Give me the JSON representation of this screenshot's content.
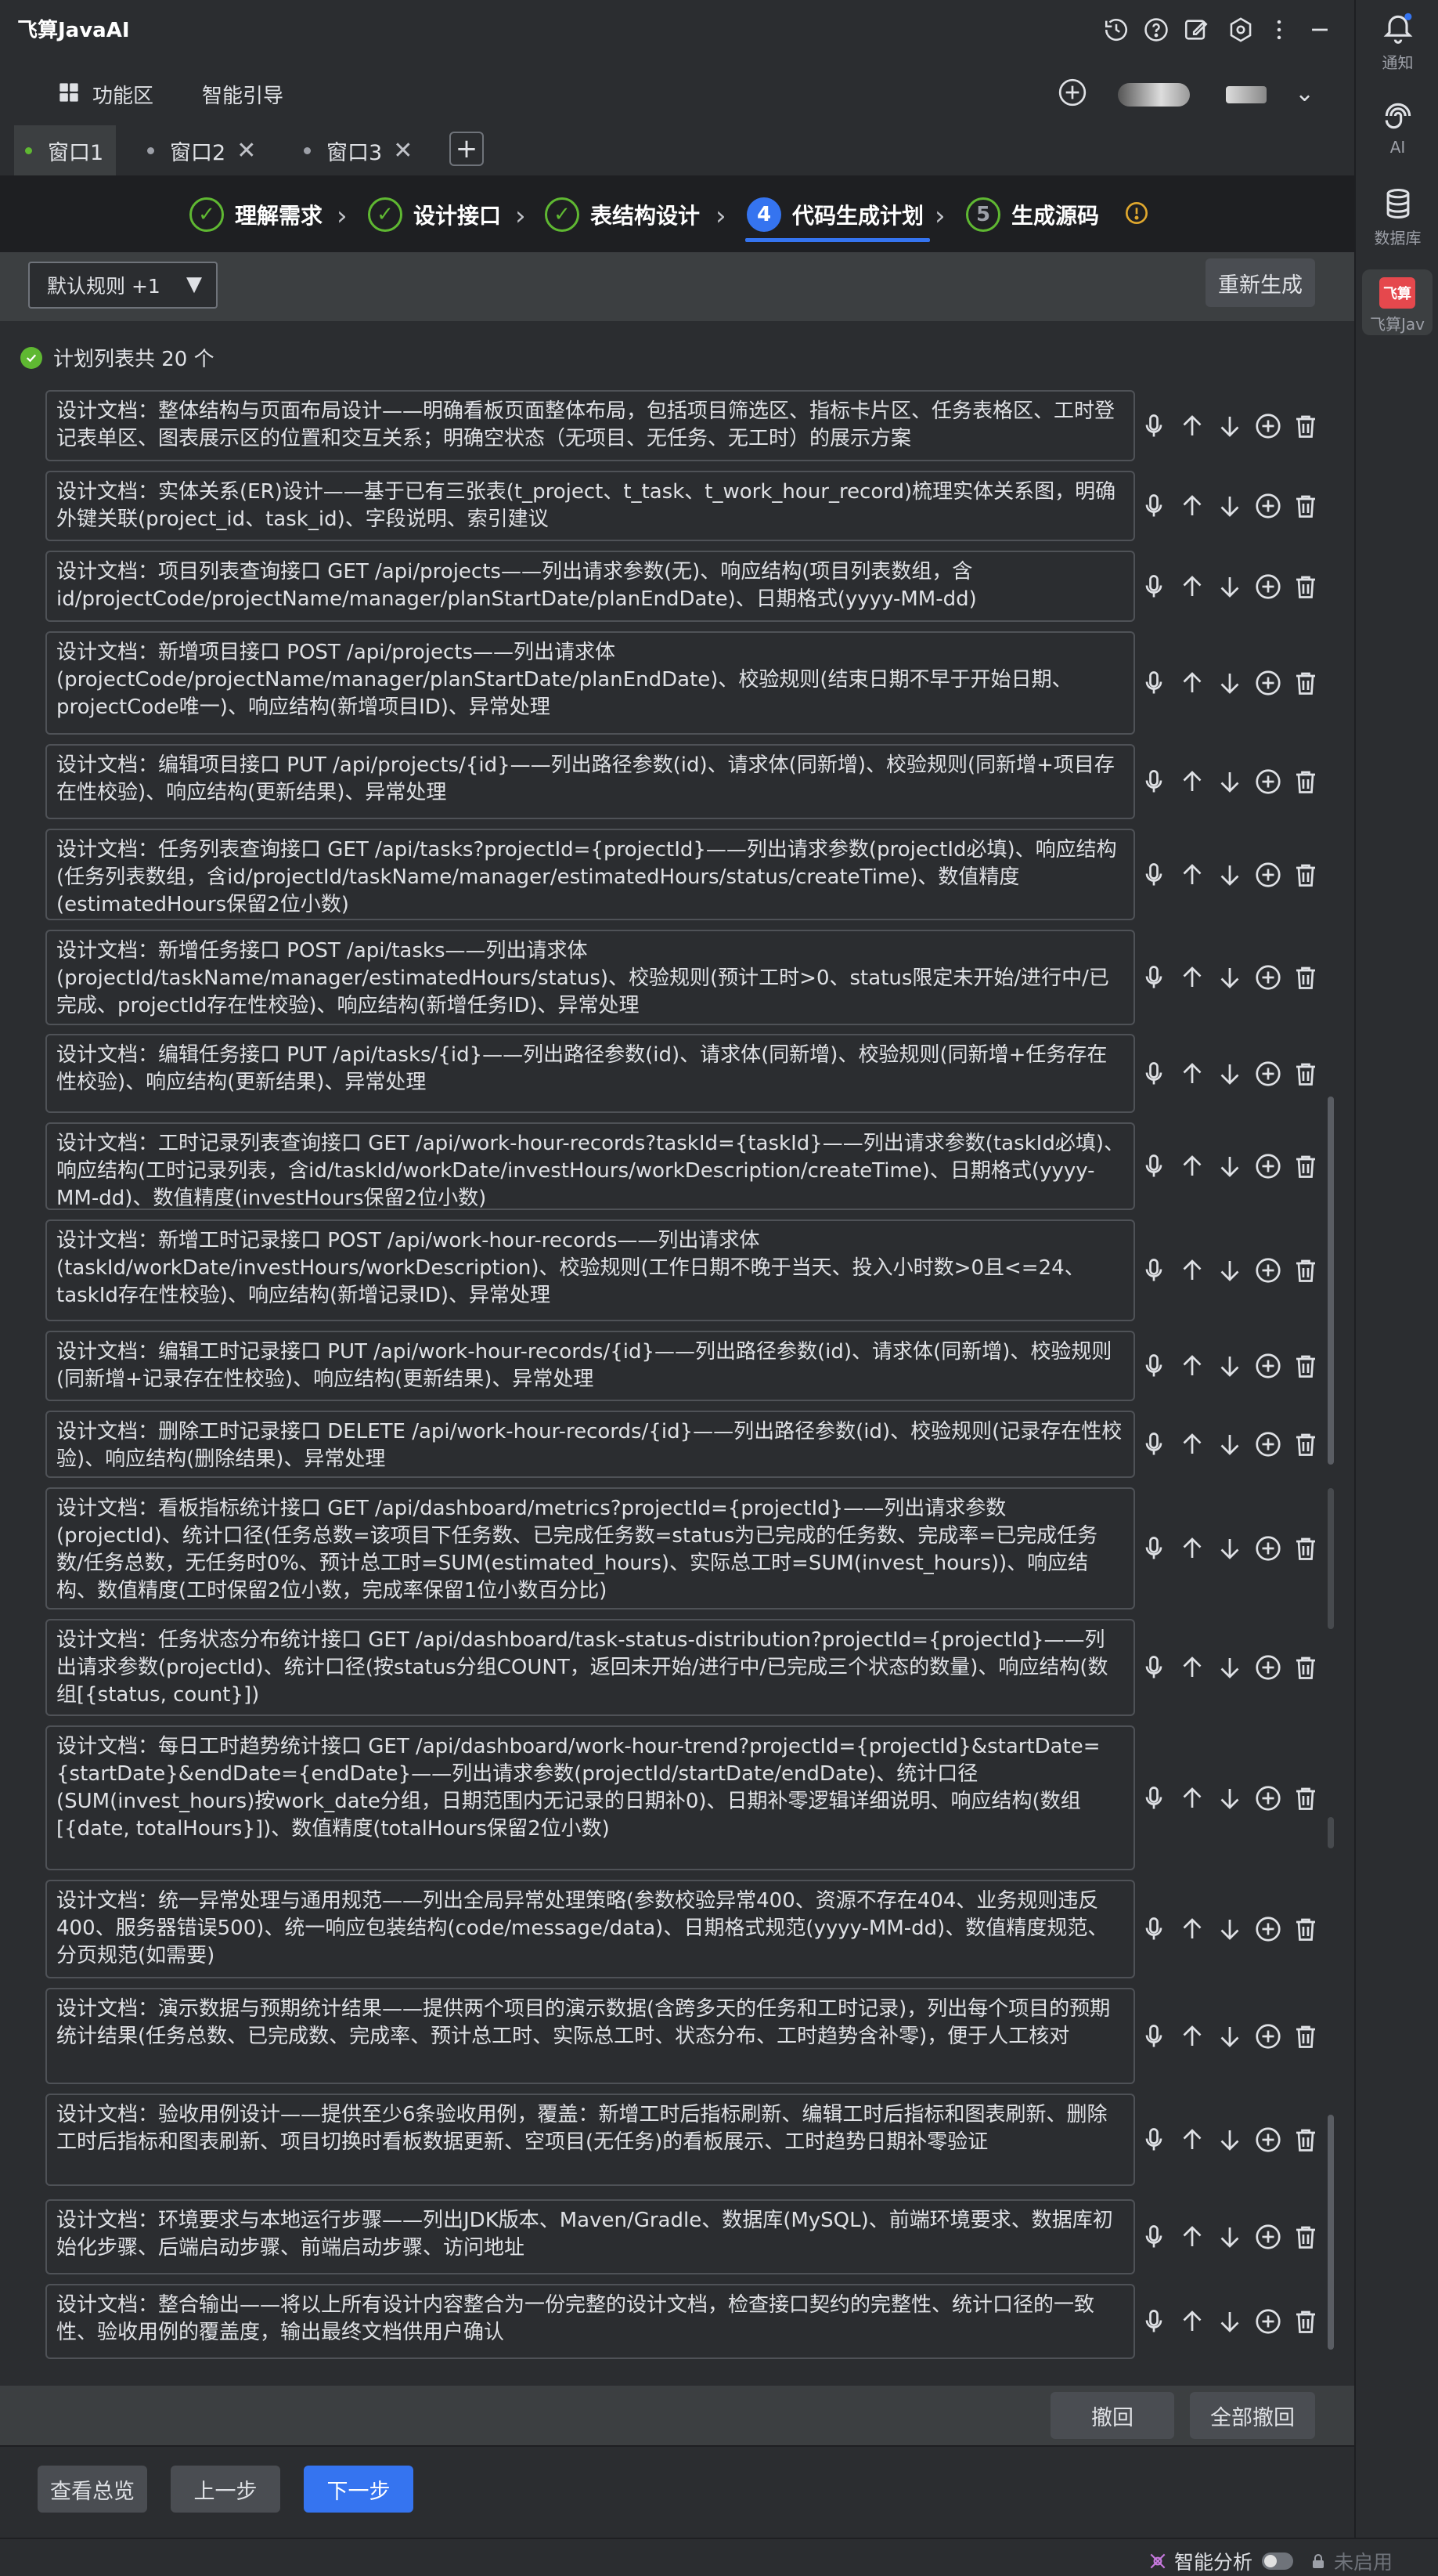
{
  "app": {
    "title": "飞算JavaAI"
  },
  "right_sidebar": {
    "items": [
      {
        "label": "通知",
        "icon": "bell-icon"
      },
      {
        "label": "AI",
        "icon": "ai-swirl-icon"
      },
      {
        "label": "数据库",
        "icon": "database-icon"
      },
      {
        "label": "飞算Jav",
        "icon": "feisuan-logo-icon",
        "badge": "飞算"
      }
    ]
  },
  "menu": {
    "items": [
      "功能区",
      "智能引导"
    ]
  },
  "window_tabs": [
    {
      "label": "窗口1",
      "active": true
    },
    {
      "label": "窗口2",
      "active": false
    },
    {
      "label": "窗口3",
      "active": false
    }
  ],
  "steps": [
    {
      "number": "✓",
      "label": "理解需求",
      "state": "done"
    },
    {
      "number": "✓",
      "label": "设计接口",
      "state": "done"
    },
    {
      "number": "✓",
      "label": "表结构设计",
      "state": "done"
    },
    {
      "number": "4",
      "label": "代码生成计划",
      "state": "active"
    },
    {
      "number": "5",
      "label": "生成源码",
      "state": "todo"
    }
  ],
  "toolbar": {
    "rule_select_value": "默认规则 +1",
    "regenerate_label": "重新生成"
  },
  "plan": {
    "count_label": "计划列表共 20 个",
    "items": [
      "设计文档：整体结构与页面布局设计——明确看板页面整体布局，包括项目筛选区、指标卡片区、任务表格区、工时登记表单区、图表展示区的位置和交互关系；明确空状态（无项目、无任务、无工时）的展示方案",
      "设计文档：实体关系(ER)设计——基于已有三张表(t_project、t_task、t_work_hour_record)梳理实体关系图，明确外键关联(project_id、task_id)、字段说明、索引建议",
      "设计文档：项目列表查询接口 GET /api/projects——列出请求参数(无)、响应结构(项目列表数组，含id/projectCode/projectName/manager/planStartDate/planEndDate)、日期格式(yyyy-MM-dd)",
      "设计文档：新增项目接口 POST /api/projects——列出请求体(projectCode/projectName/manager/planStartDate/planEndDate)、校验规则(结束日期不早于开始日期、projectCode唯一)、响应结构(新增项目ID)、异常处理",
      "设计文档：编辑项目接口 PUT /api/projects/{id}——列出路径参数(id)、请求体(同新增)、校验规则(同新增+项目存在性校验)、响应结构(更新结果)、异常处理",
      "设计文档：任务列表查询接口 GET /api/tasks?projectId={projectId}——列出请求参数(projectId必填)、响应结构(任务列表数组，含id/projectId/taskName/manager/estimatedHours/status/createTime)、数值精度(estimatedHours保留2位小数)",
      "设计文档：新增任务接口 POST /api/tasks——列出请求体(projectId/taskName/manager/estimatedHours/status)、校验规则(预计工时>0、status限定未开始/进行中/已完成、projectId存在性校验)、响应结构(新增任务ID)、异常处理",
      "设计文档：编辑任务接口 PUT /api/tasks/{id}——列出路径参数(id)、请求体(同新增)、校验规则(同新增+任务存在性校验)、响应结构(更新结果)、异常处理",
      "设计文档：工时记录列表查询接口 GET /api/work-hour-records?taskId={taskId}——列出请求参数(taskId必填)、响应结构(工时记录列表，含id/taskId/workDate/investHours/workDescription/createTime)、日期格式(yyyy-MM-dd)、数值精度(investHours保留2位小数)",
      "设计文档：新增工时记录接口 POST /api/work-hour-records——列出请求体(taskId/workDate/investHours/workDescription)、校验规则(工作日期不晚于当天、投入小时数>0且<=24、taskId存在性校验)、响应结构(新增记录ID)、异常处理",
      "设计文档：编辑工时记录接口 PUT /api/work-hour-records/{id}——列出路径参数(id)、请求体(同新增)、校验规则(同新增+记录存在性校验)、响应结构(更新结果)、异常处理",
      "设计文档：删除工时记录接口 DELETE /api/work-hour-records/{id}——列出路径参数(id)、校验规则(记录存在性校验)、响应结构(删除结果)、异常处理",
      "设计文档：看板指标统计接口 GET /api/dashboard/metrics?projectId={projectId}——列出请求参数(projectId)、统计口径(任务总数=该项目下任务数、已完成任务数=status为已完成的任务数、完成率=已完成任务数/任务总数，无任务时0%、预计总工时=SUM(estimated_hours)、实际总工时=SUM(invest_hours))、响应结构、数值精度(工时保留2位小数，完成率保留1位小数百分比)",
      "设计文档：任务状态分布统计接口 GET /api/dashboard/task-status-distribution?projectId={projectId}——列出请求参数(projectId)、统计口径(按status分组COUNT，返回未开始/进行中/已完成三个状态的数量)、响应结构(数组[{status, count}])",
      "设计文档：每日工时趋势统计接口 GET /api/dashboard/work-hour-trend?projectId={projectId}&startDate={startDate}&endDate={endDate}——列出请求参数(projectId/startDate/endDate)、统计口径(SUM(invest_hours)按work_date分组，日期范围内无记录的日期补0)、日期补零逻辑详细说明、响应结构(数组[{date, totalHours}])、数值精度(totalHours保留2位小数)",
      "设计文档：统一异常处理与通用规范——列出全局异常处理策略(参数校验异常400、资源不存在404、业务规则违反400、服务器错误500)、统一响应包装结构(code/message/data)、日期格式规范(yyyy-MM-dd)、数值精度规范、分页规范(如需要)",
      "设计文档：演示数据与预期统计结果——提供两个项目的演示数据(含跨多天的任务和工时记录)，列出每个项目的预期统计结果(任务总数、已完成数、完成率、预计总工时、实际总工时、状态分布、工时趋势含补零)，便于人工核对",
      "设计文档：验收用例设计——提供至少6条验收用例，覆盖：新增工时后指标刷新、编辑工时后指标和图表刷新、删除工时后指标和图表刷新、项目切换时看板数据更新、空项目(无任务)的看板展示、工时趋势日期补零验证",
      "设计文档：环境要求与本地运行步骤——列出JDK版本、Maven/Gradle、数据库(MySQL)、前端环境要求、数据库初始化步骤、后端启动步骤、前端启动步骤、访问地址",
      "设计文档：整合输出——将以上所有设计内容整合为一份完整的设计文档，检查接口契约的完整性、统计口径的一致性、验收用例的覆盖度，输出最终文档供用户确认"
    ]
  },
  "bottom": {
    "undo_label": "撤回",
    "undo_all_label": "全部撤回",
    "overview_label": "查看总览",
    "prev_label": "上一步",
    "next_label": "下一步"
  },
  "status_bar": {
    "smart_analysis_label": "智能分析",
    "disabled_label": "未启用"
  },
  "colors": {
    "accent": "#3574f0",
    "success": "#5fb832",
    "badge_red": "#e5484d"
  }
}
